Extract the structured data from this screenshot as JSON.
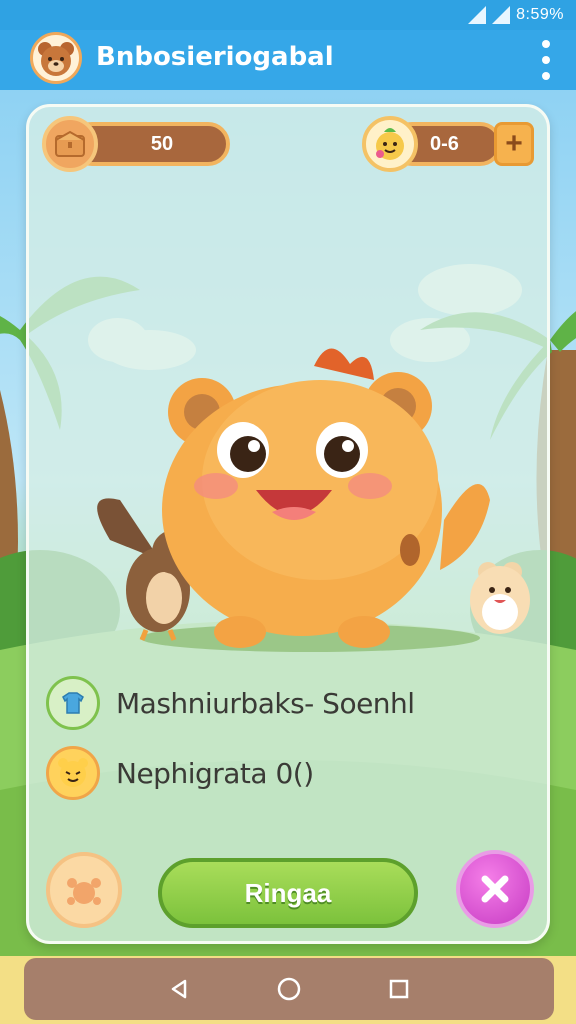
{
  "status_bar": {
    "time": "8:59%"
  },
  "app_bar": {
    "title": "Bnbosieriogabal",
    "menu_icon": "more-vert-icon",
    "avatar_icon": "bear-avatar-icon"
  },
  "hud": {
    "coins": {
      "value": "50",
      "icon": "treasure-chest-icon"
    },
    "gems": {
      "value": "0-6",
      "icon": "fruit-character-icon",
      "add_label": "+"
    }
  },
  "info": [
    {
      "icon": "shirt-icon",
      "text": "Mashniurbaks- Soenhl"
    },
    {
      "icon": "tiger-face-icon",
      "text": "Nephigrata 0()"
    }
  ],
  "actions": {
    "main_label": "Ringaa",
    "left_icon": "paw-icon",
    "right_icon": "close-icon"
  },
  "nav": {
    "back_icon": "back-triangle-icon",
    "home_icon": "home-circle-icon",
    "recents_icon": "recents-square-icon"
  },
  "colors": {
    "app_bar": "#35a7e8",
    "button_green": "#7cc23c",
    "close_pink": "#c63bc3",
    "pill_brown": "#a8673d",
    "nav": "#a67f6b"
  }
}
